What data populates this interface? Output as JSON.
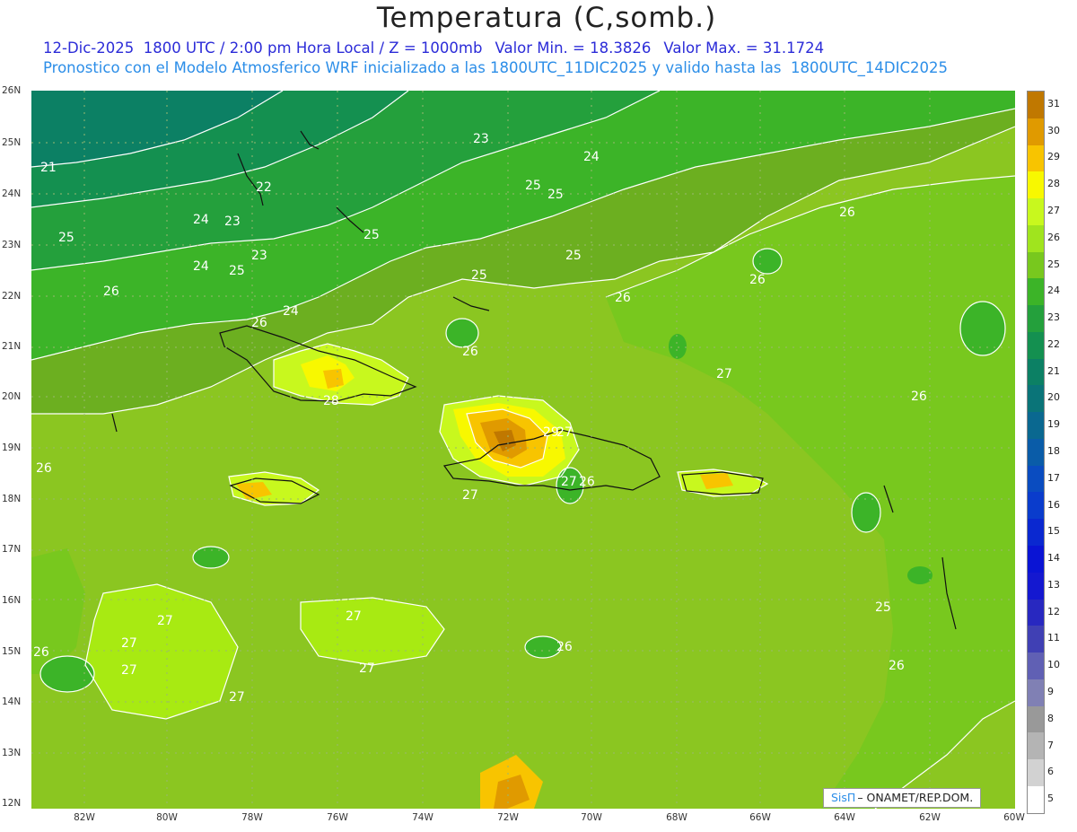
{
  "header": {
    "title": "Temperatura (C,somb.)",
    "line1": {
      "datetime": "12-Dic-2025  1800 UTC / 2:00 pm Hora Local / Z = 1000mb",
      "min": "Valor Min. = 18.3826",
      "max": "Valor Max. = 31.1724"
    },
    "line2": "Pronostico con el Modelo Atmosferico WRF inicializado a las 1800UTC_11DIC2025 y valido hasta las  1800UTC_14DIC2025"
  },
  "axes": {
    "lat_labels": [
      "26N",
      "25N",
      "24N",
      "23N",
      "22N",
      "21N",
      "20N",
      "19N",
      "18N",
      "17N",
      "16N",
      "15N",
      "14N",
      "13N",
      "12N"
    ],
    "lon_labels": [
      "82W",
      "80W",
      "78W",
      "76W",
      "74W",
      "72W",
      "70W",
      "68W",
      "66W",
      "64W",
      "62W",
      "60W"
    ]
  },
  "colorbar": {
    "levels": [
      "31",
      "30",
      "29",
      "28",
      "27",
      "26",
      "25",
      "24",
      "23",
      "22",
      "21",
      "20",
      "19",
      "18",
      "17",
      "16",
      "15",
      "14",
      "13",
      "12",
      "11",
      "10",
      "9",
      "8",
      "7",
      "6",
      "5"
    ],
    "colors": [
      "#c07800",
      "#e09a00",
      "#f8c400",
      "#f8f800",
      "#c8f81e",
      "#a0e41e",
      "#78c81e",
      "#3cb428",
      "#24a03c",
      "#149050",
      "#0c8064",
      "#0a7478",
      "#0a6890",
      "#0a5ca8",
      "#0a4cc0",
      "#0a3ccc",
      "#0a28d0",
      "#0a14d4",
      "#1418d0",
      "#2828c0",
      "#4040b4",
      "#6060b4",
      "#8080b4",
      "#999999",
      "#b4b4b4",
      "#d2d2d2",
      "#ffffff"
    ]
  },
  "contour_labels": [
    "21",
    "23",
    "22",
    "23",
    "24",
    "25",
    "24",
    "25",
    "24",
    "26",
    "25",
    "23",
    "24",
    "25",
    "25",
    "25",
    "25",
    "26",
    "26",
    "26",
    "26",
    "26",
    "26",
    "27",
    "27",
    "27",
    "27",
    "27",
    "27",
    "27",
    "26",
    "26",
    "25",
    "26",
    "27",
    "27",
    "28",
    "29",
    "27",
    "26",
    "26"
  ],
  "credit": {
    "brand": "SisΠ",
    "text": "– ONAMET/REP.DOM."
  }
}
